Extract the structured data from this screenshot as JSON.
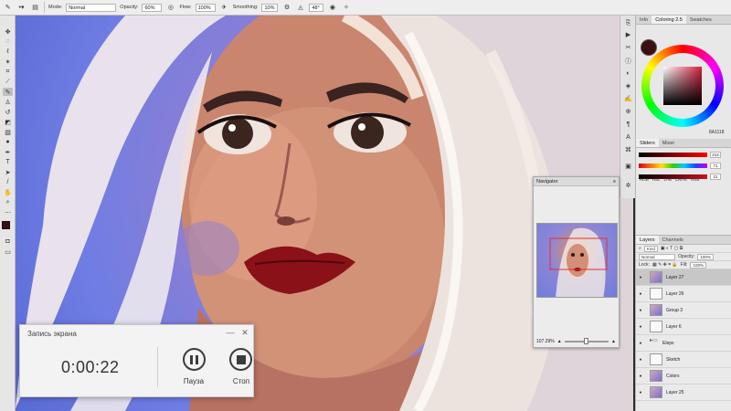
{
  "options_bar": {
    "mode_label": "Mode:",
    "mode_value": "Normal",
    "opacity_label": "Opacity:",
    "opacity_value": "60%",
    "flow_label": "Flow:",
    "flow_value": "100%",
    "smoothing_label": "Smoothing:",
    "smoothing_value": "10%",
    "angle_value": "48°"
  },
  "right_panel": {
    "top_tabs": [
      "Info",
      "Coloring 2.5",
      "Swatches"
    ],
    "hex_value": "8A1118",
    "slider_tabs": [
      "Sliders",
      "Mixer"
    ],
    "slider_values": [
      "212",
      "71",
      "21"
    ],
    "color_modes": [
      "RGB",
      "HSL",
      "LAB",
      "CMYK",
      "HSB"
    ],
    "layer_tabs": [
      "Layers",
      "Channels"
    ],
    "kind_label": "Kind",
    "blend_mode": "Normal",
    "opacity_label": "Opacity:",
    "opacity_value": "100%",
    "lock_label": "Lock:",
    "fill_label": "Fill:",
    "fill_value": "100%",
    "layers": [
      {
        "name": "Layer 27",
        "thumb": "face",
        "selected": true
      },
      {
        "name": "Layer 26",
        "thumb": "white",
        "selected": false
      },
      {
        "name": "Group 3",
        "thumb": "face",
        "selected": false
      },
      {
        "name": "Layer 6",
        "thumb": "white",
        "selected": false
      },
      {
        "name": "Eleps",
        "thumb": "folder",
        "selected": false
      },
      {
        "name": "Sketch",
        "thumb": "white",
        "selected": false
      },
      {
        "name": "Colors",
        "thumb": "face",
        "selected": false
      },
      {
        "name": "Layer 25",
        "thumb": "face",
        "selected": false
      }
    ]
  },
  "navigator": {
    "title": "Navigator",
    "zoom": "107.29%"
  },
  "recorder": {
    "title": "Запись экрана",
    "time": "0:00:22",
    "pause_label": "Пауза",
    "stop_label": "Стоп"
  },
  "colors": {
    "foreground": "#3b0e12",
    "canvas_bg": "#6f7de4",
    "lips": "#8a1118"
  },
  "icons": {
    "toolbar": [
      "move-icon",
      "marquee-icon",
      "lasso-icon",
      "magic-wand-icon",
      "crop-icon",
      "eyedropper-icon",
      "healing-icon",
      "brush-icon",
      "clone-stamp-icon",
      "history-brush-icon",
      "eraser-icon",
      "gradient-icon",
      "blur-icon",
      "dodge-icon",
      "pen-icon",
      "type-icon",
      "path-select-icon",
      "shape-icon",
      "hand-icon",
      "zoom-icon",
      "more-icon"
    ]
  }
}
